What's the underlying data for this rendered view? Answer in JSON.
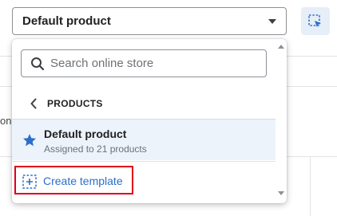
{
  "background": {
    "partial_text": "on"
  },
  "template_select": {
    "value": "Default product"
  },
  "inspector_button": {
    "icon": "select-element-icon",
    "accent_bg": "#e6eef8",
    "accent_fg": "#2c6ecb"
  },
  "dropdown": {
    "search": {
      "placeholder": "Search online store",
      "icon": "search-icon"
    },
    "section": {
      "back_icon": "chevron-left-icon",
      "label": "PRODUCTS"
    },
    "items": [
      {
        "icon": "star-icon",
        "title": "Default product",
        "subtitle": "Assigned to 21 products",
        "selected": true
      }
    ],
    "create_action": {
      "icon": "plus-square-icon",
      "label": "Create template",
      "highlight_color": "#e0001b",
      "link_color": "#2c6ecb"
    }
  }
}
